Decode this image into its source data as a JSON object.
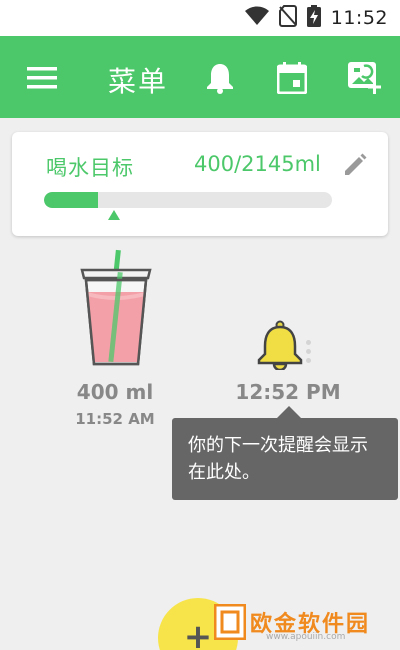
{
  "status_bar": {
    "time": "11:52",
    "icons": [
      "wifi-icon",
      "no-sim-icon",
      "battery-charging-icon"
    ]
  },
  "app_bar": {
    "menu_icon": "hamburger-menu-icon",
    "title": "菜单",
    "actions": [
      "bell-icon",
      "calendar-icon",
      "add-photo-icon"
    ],
    "color": "#4cc86a"
  },
  "goal": {
    "label": "喝水目标",
    "value": "400/2145ml",
    "progress_fraction": 0.186,
    "edit_icon": "pencil-icon"
  },
  "entry": {
    "amount": "400 ml",
    "time": "11:52 AM",
    "icon": "drink-cup-icon"
  },
  "reminder": {
    "time": "12:52 PM",
    "icon": "bell-icon",
    "more_icon": "more-vertical-icon"
  },
  "tooltip": {
    "text": "你的下一次提醒会显示在此处。"
  },
  "fab": {
    "symbol": "+",
    "color": "#f7e44a"
  },
  "watermark": {
    "text": "欧金软件园",
    "url": "www.apouiin.com"
  }
}
